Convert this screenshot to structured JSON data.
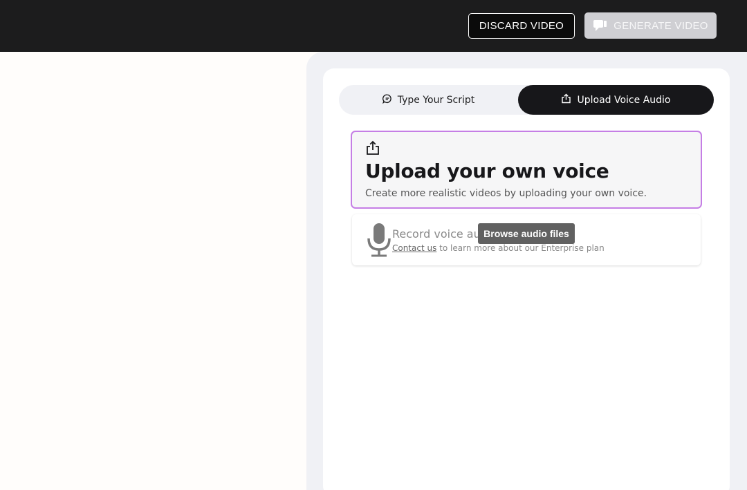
{
  "header": {
    "discard_label": "DISCARD VIDEO",
    "generate_label": "GENERATE VIDEO"
  },
  "tabs": [
    {
      "label": "Type Your Script",
      "icon": "chat-bubble-icon",
      "active": false
    },
    {
      "label": "Upload Voice Audio",
      "icon": "upload-icon",
      "active": true
    }
  ],
  "upload_card": {
    "icon": "upload-icon",
    "title": "Upload your own voice",
    "description": "Create more realistic videos by uploading your own voice."
  },
  "record_card": {
    "icon": "microphone-icon",
    "title": "Record voice aud",
    "contact_link": "Contact us",
    "subtitle_rest": " to learn more about our Enterprise plan"
  },
  "tooltip": {
    "text": "Browse audio files"
  },
  "colors": {
    "header_bg": "#1c1c1d",
    "accent_border": "#c57ee5",
    "active_tab": "#17171a",
    "panel_bg": "#f0f1f5",
    "disabled_button": "#cfcfd3"
  }
}
